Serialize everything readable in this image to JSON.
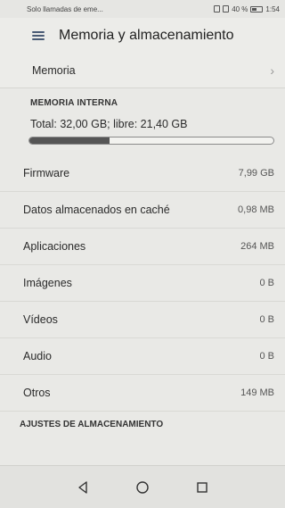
{
  "status": {
    "carrier_text": "Solo llamadas de eme...",
    "battery_pct": "40 %",
    "time": "1:54"
  },
  "appbar": {
    "title": "Memoria y almacenamiento"
  },
  "memory_row": {
    "label": "Memoria"
  },
  "internal": {
    "header": "MEMORIA INTERNA",
    "total_text": "Total: 32,00 GB; libre: 21,40 GB",
    "used_fraction": 0.33
  },
  "items": [
    {
      "label": "Firmware",
      "value": "7,99 GB"
    },
    {
      "label": "Datos almacenados en caché",
      "value": "0,98 MB"
    },
    {
      "label": "Aplicaciones",
      "value": "264 MB"
    },
    {
      "label": "Imágenes",
      "value": "0 B"
    },
    {
      "label": "Vídeos",
      "value": "0 B"
    },
    {
      "label": "Audio",
      "value": "0 B"
    },
    {
      "label": "Otros",
      "value": "149 MB"
    }
  ],
  "settings": {
    "header": "AJUSTES DE ALMACENAMIENTO"
  },
  "icons": {
    "nav_back": "triangle-back-icon",
    "nav_home": "circle-home-icon",
    "nav_recents": "square-recents-icon"
  }
}
